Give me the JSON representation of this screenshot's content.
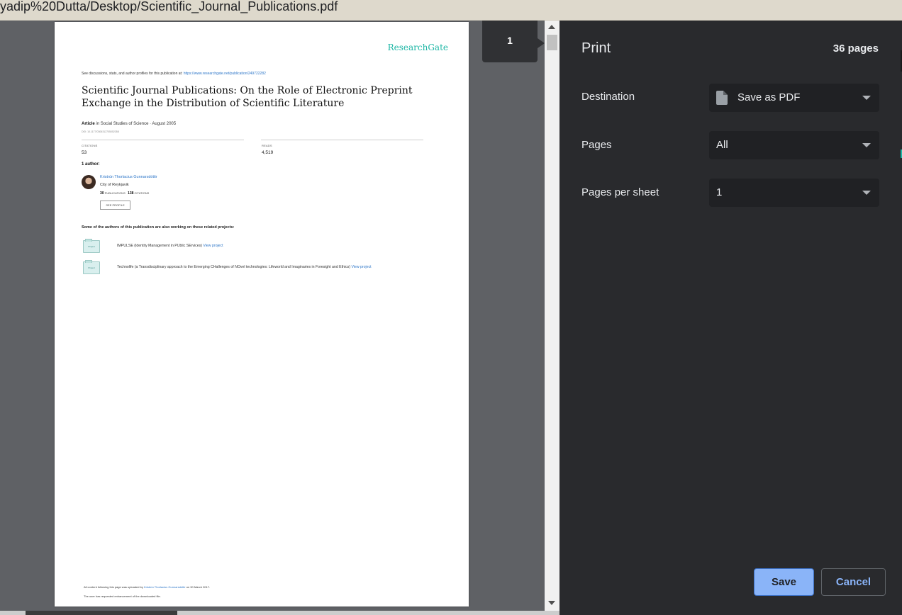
{
  "window": {
    "url_text": "yadip%20Dutta/Desktop/Scientific_Journal_Publications.pdf"
  },
  "preview": {
    "page_indicator": "1",
    "document": {
      "brand": "ResearchGate",
      "see_text": "See discussions, stats, and author profiles for this publication at:",
      "see_link": "https://www.researchgate.net/publication/249722282",
      "title": "Scientific Journal Publications: On the Role of Electronic Preprint Exchange in the Distribution of Scientific Literature",
      "article_label": "Article",
      "in_label": "in",
      "journal": "Social Studies of Science · August 2005",
      "doi": "DOI: 10.1177/0306312705052358",
      "citations_label": "CITATIONS",
      "citations_value": "53",
      "reads_label": "READS",
      "reads_value": "4,519",
      "authors_heading": "1 author:",
      "author_name": "Kristrún Thorlacius Gunnarsdóttir",
      "author_institution": "City of Reykjavik",
      "author_pubs_count": "30",
      "author_pubs_label": "PUBLICATIONS",
      "author_cit_count": "138",
      "author_cit_label": "CITATIONS",
      "see_profile": "SEE PROFILE",
      "related_heading": "Some of the authors of this publication are also working on these related projects:",
      "projects": [
        {
          "icon_label": "Project",
          "text": "IMPULSE (Identity Management in PUblic SErvices)",
          "link": "View project"
        },
        {
          "icon_label": "Project",
          "text": "Technolife (a Transdisciplinary approach to the Emerging CHallenges of NOvel technologies: Lifeworld and Imaginaries in Foresight and Ethics)",
          "link": "View project"
        }
      ],
      "footer_prefix": "All content following this page was uploaded by",
      "footer_author": "Kristrún Thorlacius Gunnarsdóttir",
      "footer_suffix": "on 30 March 2017.",
      "footer_note": "The user has requested enhancement of the downloaded file."
    }
  },
  "print_panel": {
    "title": "Print",
    "page_count": "36 pages",
    "destination_label": "Destination",
    "destination_value": "Save as PDF",
    "pages_label": "Pages",
    "pages_value": "All",
    "pps_label": "Pages per sheet",
    "pps_value": "1",
    "save_label": "Save",
    "cancel_label": "Cancel"
  },
  "colors": {
    "panel_bg": "#292a2d",
    "select_bg": "#202124",
    "accent": "#8ab4f8",
    "brand_teal": "#1fb7a6"
  }
}
